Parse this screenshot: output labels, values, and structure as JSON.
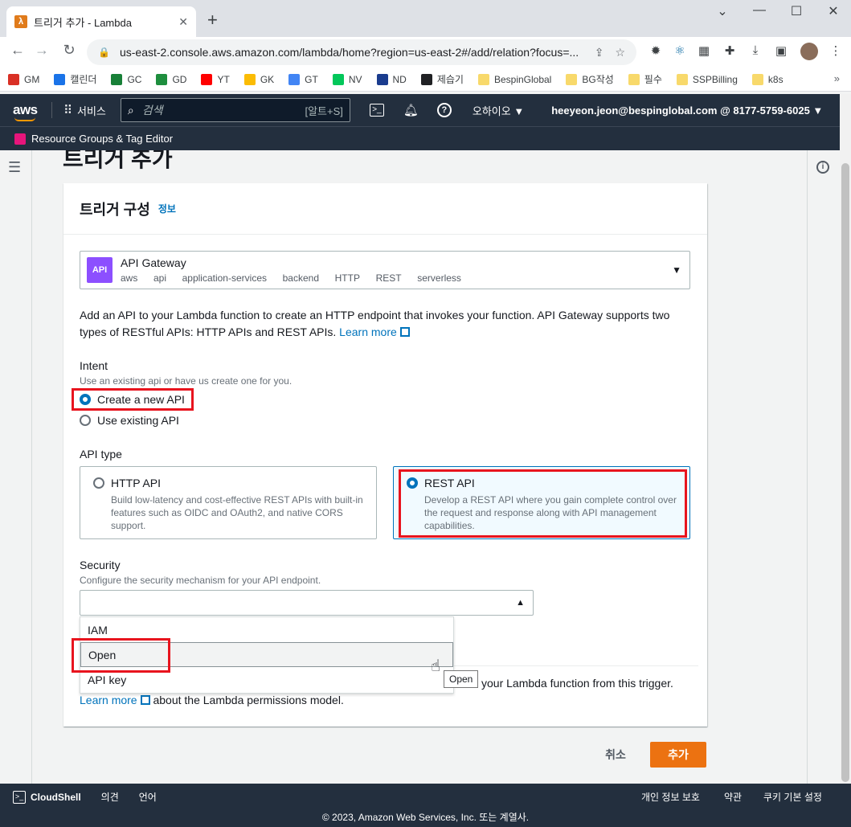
{
  "browser": {
    "tab_title": "트리거 추가 - Lambda",
    "tab_favicon": "λ",
    "url": "us-east-2.console.aws.amazon.com/lambda/home?region=us-east-2#/add/relation?focus=...",
    "bookmarks": [
      "GM",
      "캘린더",
      "GC",
      "GD",
      "YT",
      "GK",
      "GT",
      "NV",
      "ND",
      "제습기",
      "BespinGlobal",
      "BG작성",
      "필수",
      "SSPBilling",
      "k8s"
    ],
    "bookmark_colors": [
      "#d93025",
      "#1a73e8",
      "#188038",
      "#1e8e3e",
      "#ff0000",
      "#fbbc04",
      "#4285f4",
      "#03c75a",
      "#1a3c8e",
      "#202124",
      "#f8d96b",
      "#f8d96b",
      "#f8d96b",
      "#f8d96b",
      "#f8d96b"
    ],
    "bookmark_more": "»"
  },
  "aws_header": {
    "logo": "aws",
    "services": "서비스",
    "search_placeholder": "검색",
    "search_shortcut": "[알트+S]",
    "region": "오하이오 ▼",
    "account": "heeyeon.jeon@bespinglobal.com @ 8177-5759-6025 ▼",
    "resource_groups": "Resource Groups & Tag Editor"
  },
  "page": {
    "title": "트리거 추가",
    "panel_title": "트리거 구성",
    "panel_info": "정보",
    "trigger": {
      "name": "API Gateway",
      "icon_label": "API",
      "tags": [
        "aws",
        "api",
        "application-services",
        "backend",
        "HTTP",
        "REST",
        "serverless"
      ]
    },
    "description": "Add an API to your Lambda function to create an HTTP endpoint that invokes your function. API Gateway supports two types of RESTful APIs: HTTP APIs and REST APIs.",
    "learn_more": "Learn more",
    "intent": {
      "label": "Intent",
      "desc": "Use an existing api or have us create one for you.",
      "options": [
        "Create a new API",
        "Use existing API"
      ],
      "selected": "Create a new API"
    },
    "api_type": {
      "label": "API type",
      "http": {
        "title": "HTTP API",
        "desc": "Build low-latency and cost-effective REST APIs with built-in features such as OIDC and OAuth2, and native CORS support."
      },
      "rest": {
        "title": "REST API",
        "desc": "Develop a REST API where you gain complete control over the request and response along with API management capabilities."
      },
      "selected": "REST API"
    },
    "security": {
      "label": "Security",
      "desc": "Configure the security mechanism for your API endpoint.",
      "value": "",
      "options": [
        "IAM",
        "Open",
        "API key"
      ],
      "hovered": "Open"
    },
    "tooltip": "Open",
    "permissions_line1": "your Lambda function from this trigger.",
    "permissions_learn_more": "Learn more",
    "permissions_line2": "about the Lambda permissions model.",
    "cancel": "취소",
    "add": "추가"
  },
  "footer": {
    "cloudshell": "CloudShell",
    "feedback": "의견",
    "language": "언어",
    "privacy": "개인 정보 보호",
    "terms": "약관",
    "cookies": "쿠키 기본 설정",
    "copyright": "© 2023, Amazon Web Services, Inc. 또는 계열사."
  },
  "colors": {
    "highlight": "#e8141e",
    "primary_button": "#ec7211",
    "link": "#0073bb",
    "header_bg": "#232f3e"
  }
}
